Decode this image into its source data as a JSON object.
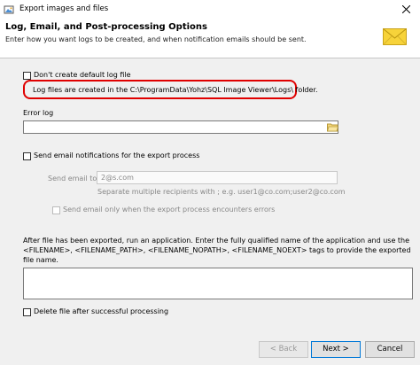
{
  "window": {
    "title": "Export images and files",
    "close_glyph": "✕"
  },
  "header": {
    "title": "Log, Email, and Post-processing Options",
    "subtitle": "Enter how you want logs to be created, and when notification emails should be sent.",
    "icon": "envelope-icon"
  },
  "log": {
    "dont_create_label": "Don't create default log file",
    "path_note": "Log files are created in the C:\\ProgramData\\Yohz\\SQL Image Viewer\\Logs\\ folder.",
    "error_log_label": "Error log",
    "error_log_value": ""
  },
  "email": {
    "send_label": "Send email notifications for the export process",
    "send_to_label": "Send email to",
    "send_to_value": "2@s.com",
    "hint": "Separate multiple recipients with ; e.g. user1@co.com;user2@co.com",
    "errors_only_label": "Send email only when the export process encounters errors"
  },
  "post": {
    "description": "After file has been exported, run an application.  Enter the fully qualified name of the application and use the <FILENAME>, <FILENAME_PATH>, <FILENAME_NOPATH>, <FILENAME_NOEXT> tags to provide the exported file name.",
    "command_value": "",
    "delete_label": "Delete file after successful processing"
  },
  "footer": {
    "back_label": "< Back",
    "next_label": "Next >",
    "cancel_label": "Cancel"
  },
  "colors": {
    "highlight": "#e00000",
    "accent": "#0078d7",
    "panel": "#f0f0f0"
  }
}
